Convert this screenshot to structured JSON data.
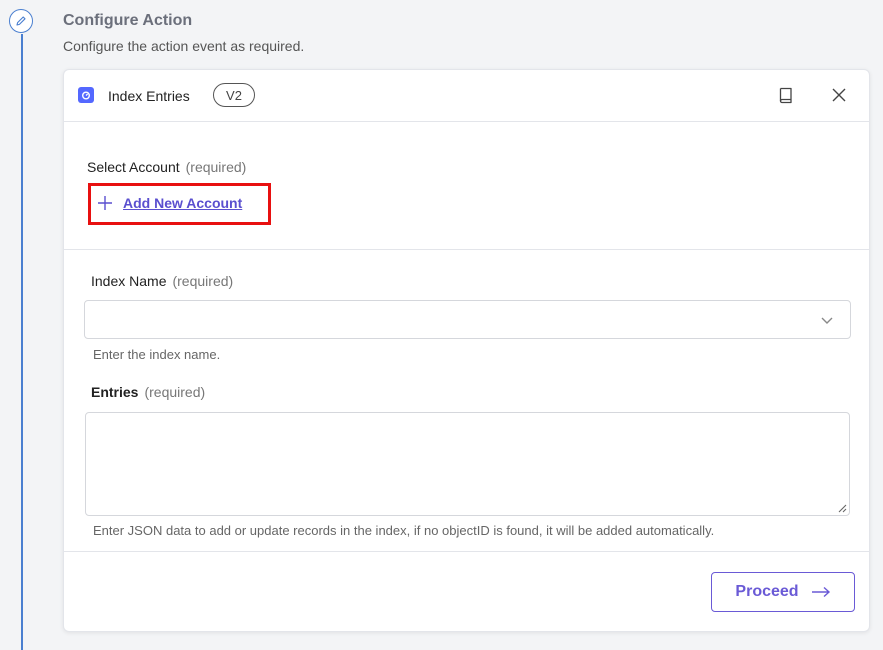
{
  "step": {
    "title": "Configure Action",
    "subtitle": "Configure the action event as required.",
    "icon": "pencil-icon"
  },
  "card": {
    "app_icon": "algolia-logo-icon",
    "action_name": "Index Entries",
    "version": "V2",
    "docs_icon": "book-icon",
    "close_icon": "close-icon"
  },
  "account": {
    "label": "Select Account",
    "required": "(required)",
    "add_label": "Add New Account"
  },
  "index_name": {
    "label": "Index Name",
    "required": "(required)",
    "value": "",
    "help": "Enter the index name."
  },
  "entries": {
    "label": "Entries",
    "required": "(required)",
    "value": "",
    "help": "Enter JSON data to add or update records in the index, if no objectID is found, it will be added automatically."
  },
  "footer": {
    "proceed_label": "Proceed"
  },
  "colors": {
    "accent": "#6a5ad6",
    "link": "#5a4fcf",
    "timeline": "#4a7fd0",
    "highlight": "#e81010",
    "app_brand": "#5468ff"
  }
}
